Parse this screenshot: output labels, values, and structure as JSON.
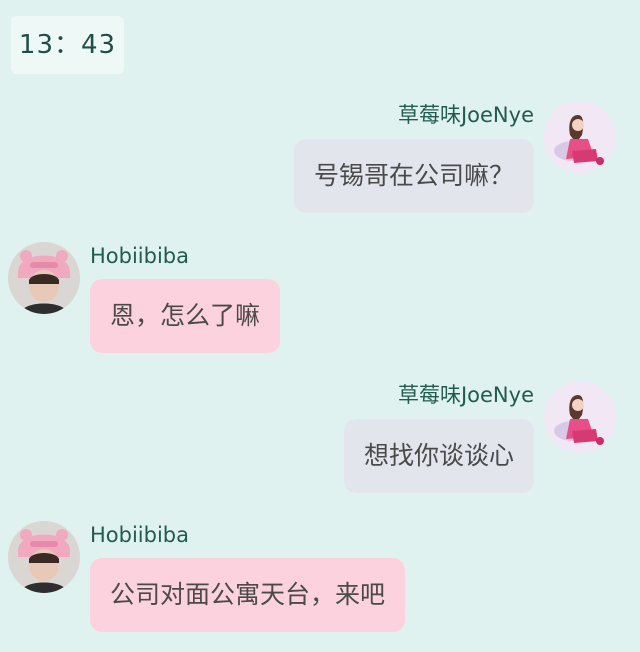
{
  "status": {
    "time": "13：43"
  },
  "messages": [
    {
      "sender": "草莓味JoeNye",
      "text": "号锡哥在公司嘛？",
      "side": "right"
    },
    {
      "sender": "Hobiibiba",
      "text": "恩，怎么了嘛",
      "side": "left"
    },
    {
      "sender": "草莓味JoeNye",
      "text": "想找你谈谈心",
      "side": "right"
    },
    {
      "sender": "Hobiibiba",
      "text": "公司对面公寓天台，来吧",
      "side": "left"
    }
  ],
  "colors": {
    "background": "#e0f2ef",
    "outgoing_bubble": "#e2e6ec",
    "incoming_bubble": "#fbd2dd",
    "name_text": "#215c50"
  },
  "icons": {
    "right_avatar": "pink-outfit-figure-avatar",
    "left_avatar": "pink-hat-person-avatar"
  }
}
